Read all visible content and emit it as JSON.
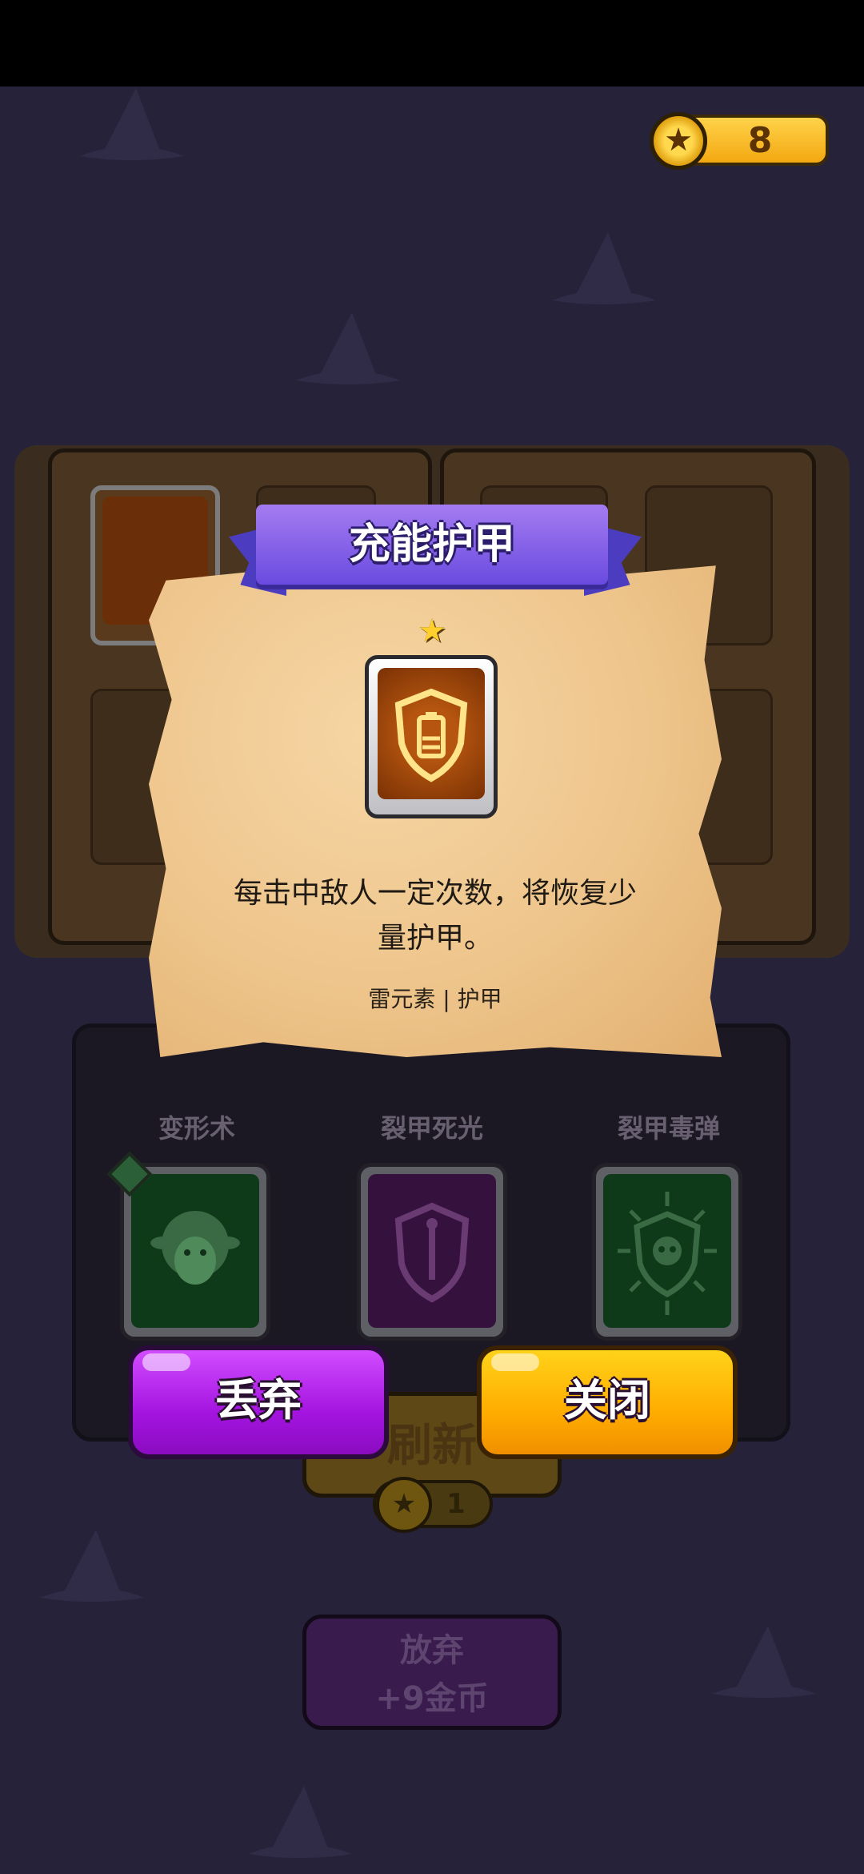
{
  "coins": {
    "value": "8"
  },
  "popup": {
    "title": "充能护甲",
    "description_line1": "每击中敌人一定次数，将恢复少",
    "description_line2": "量护甲。",
    "tags": "雷元素 | 护甲",
    "rarity_stars": "★"
  },
  "choices": [
    {
      "label": "变形术",
      "icon": "sheep-icon",
      "color": "#0f3a1a"
    },
    {
      "label": "裂甲死光",
      "icon": "shield-ray-icon",
      "color": "#35113d"
    },
    {
      "label": "裂甲毒弹",
      "icon": "skull-shield-icon",
      "color": "#0f3a1a"
    }
  ],
  "buttons": {
    "discard": "丢弃",
    "close": "关闭",
    "refresh": "刷新",
    "refresh_cost": "1",
    "giveup_line1": "放弃",
    "giveup_line2": "+9金币"
  },
  "colors": {
    "background": "#26223a",
    "discard": "#a414e0",
    "close": "#ffac00",
    "ribbon": "#6a4be0"
  }
}
